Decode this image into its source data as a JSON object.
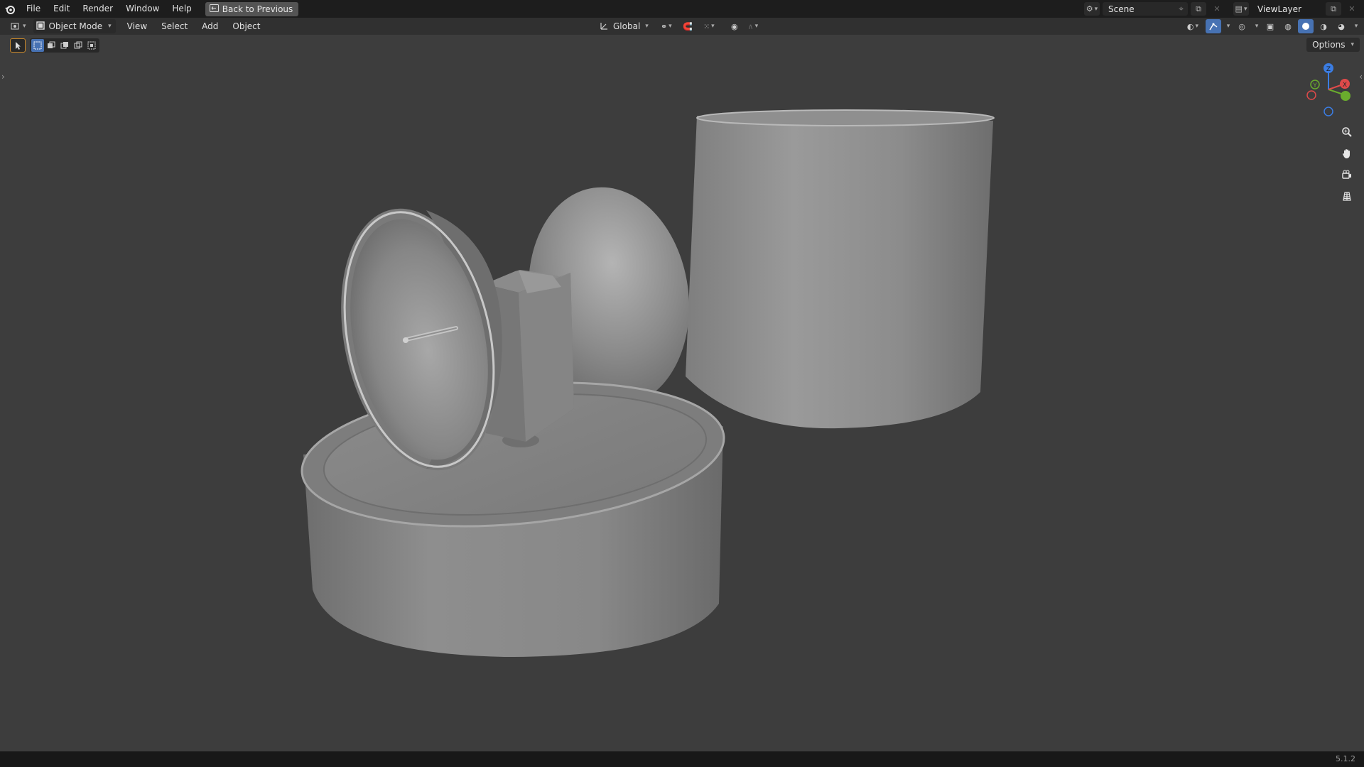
{
  "menu": {
    "items": [
      "File",
      "Edit",
      "Render",
      "Window",
      "Help"
    ],
    "back_button": "Back to Previous"
  },
  "top_right": {
    "scene": "Scene",
    "view_layer": "ViewLayer"
  },
  "header": {
    "mode": "Object Mode",
    "menus": [
      "View",
      "Select",
      "Add",
      "Object"
    ],
    "orientation": "Global",
    "options": "Options"
  },
  "viewport": {
    "objects": [
      "dish",
      "bracket",
      "egg",
      "base",
      "cylinder"
    ],
    "gizmo_axes": [
      "X",
      "Y",
      "Z"
    ],
    "nav_icons": [
      "zoom-icon",
      "pan-hand-icon",
      "camera-icon",
      "grid-icon"
    ]
  },
  "status": {
    "version": "5.1.2"
  },
  "colors": {
    "accent": "#4772b3",
    "axis_x": "#e04a4a",
    "axis_y": "#6aad2d",
    "axis_z": "#3b7de3",
    "background": "#3d3d3d"
  }
}
